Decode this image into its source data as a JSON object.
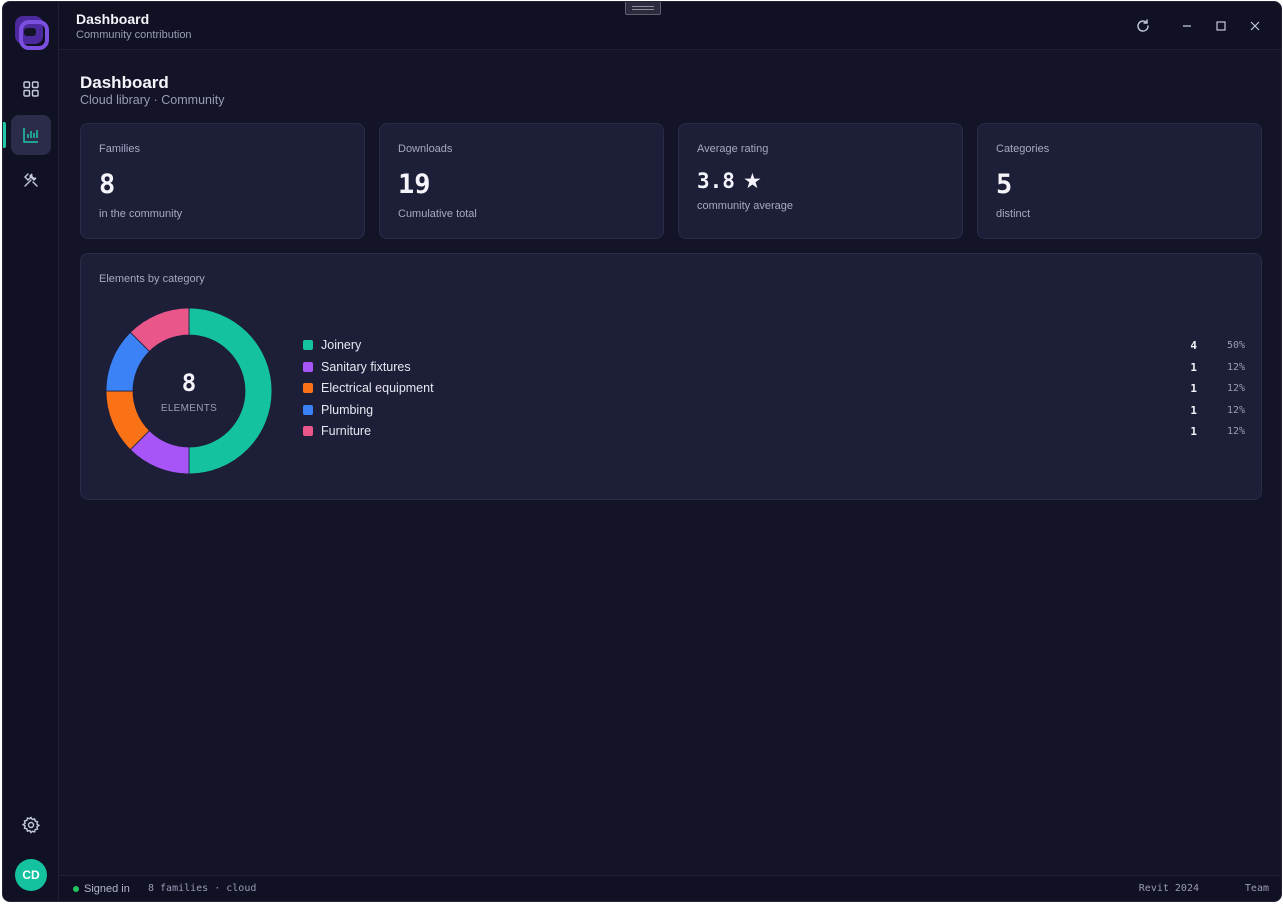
{
  "titlebar": {
    "title": "Dashboard",
    "subtitle": "Community contribution"
  },
  "rail": {
    "items": [
      {
        "icon": "grid-icon",
        "active": false
      },
      {
        "icon": "bar-chart-icon",
        "active": true
      },
      {
        "icon": "tools-icon",
        "active": false
      }
    ],
    "settings_icon": "gear-icon",
    "avatar_initials": "CD",
    "accent": "#1ec9a6"
  },
  "page": {
    "title": "Dashboard",
    "subtitle": "Cloud library · Community"
  },
  "stats": [
    {
      "label": "Families",
      "value": "8",
      "note": "in the community"
    },
    {
      "label": "Downloads",
      "value": "19",
      "note": "Cumulative total"
    },
    {
      "label": "Average rating",
      "value": "3.8",
      "note": "community average",
      "icon": "star-icon"
    },
    {
      "label": "Categories",
      "value": "5",
      "note": "distinct"
    }
  ],
  "chart_data": {
    "type": "pie",
    "title": "Elements by category",
    "center_value": "8",
    "center_label": "ELEMENTS",
    "categories": [
      "Joinery",
      "Sanitary fixtures",
      "Electrical equipment",
      "Plumbing",
      "Furniture"
    ],
    "values": [
      4,
      1,
      1,
      1,
      1
    ],
    "percent_labels": [
      "50%",
      "12%",
      "12%",
      "12%",
      "12%"
    ],
    "colors": [
      "#14c2a0",
      "#a855f7",
      "#f97316",
      "#3b82f6",
      "#e8568a"
    ]
  },
  "statusbar": {
    "signed_in": "Signed in",
    "info": "8 families · cloud",
    "revit": "Revit 2024",
    "team": "Team"
  }
}
